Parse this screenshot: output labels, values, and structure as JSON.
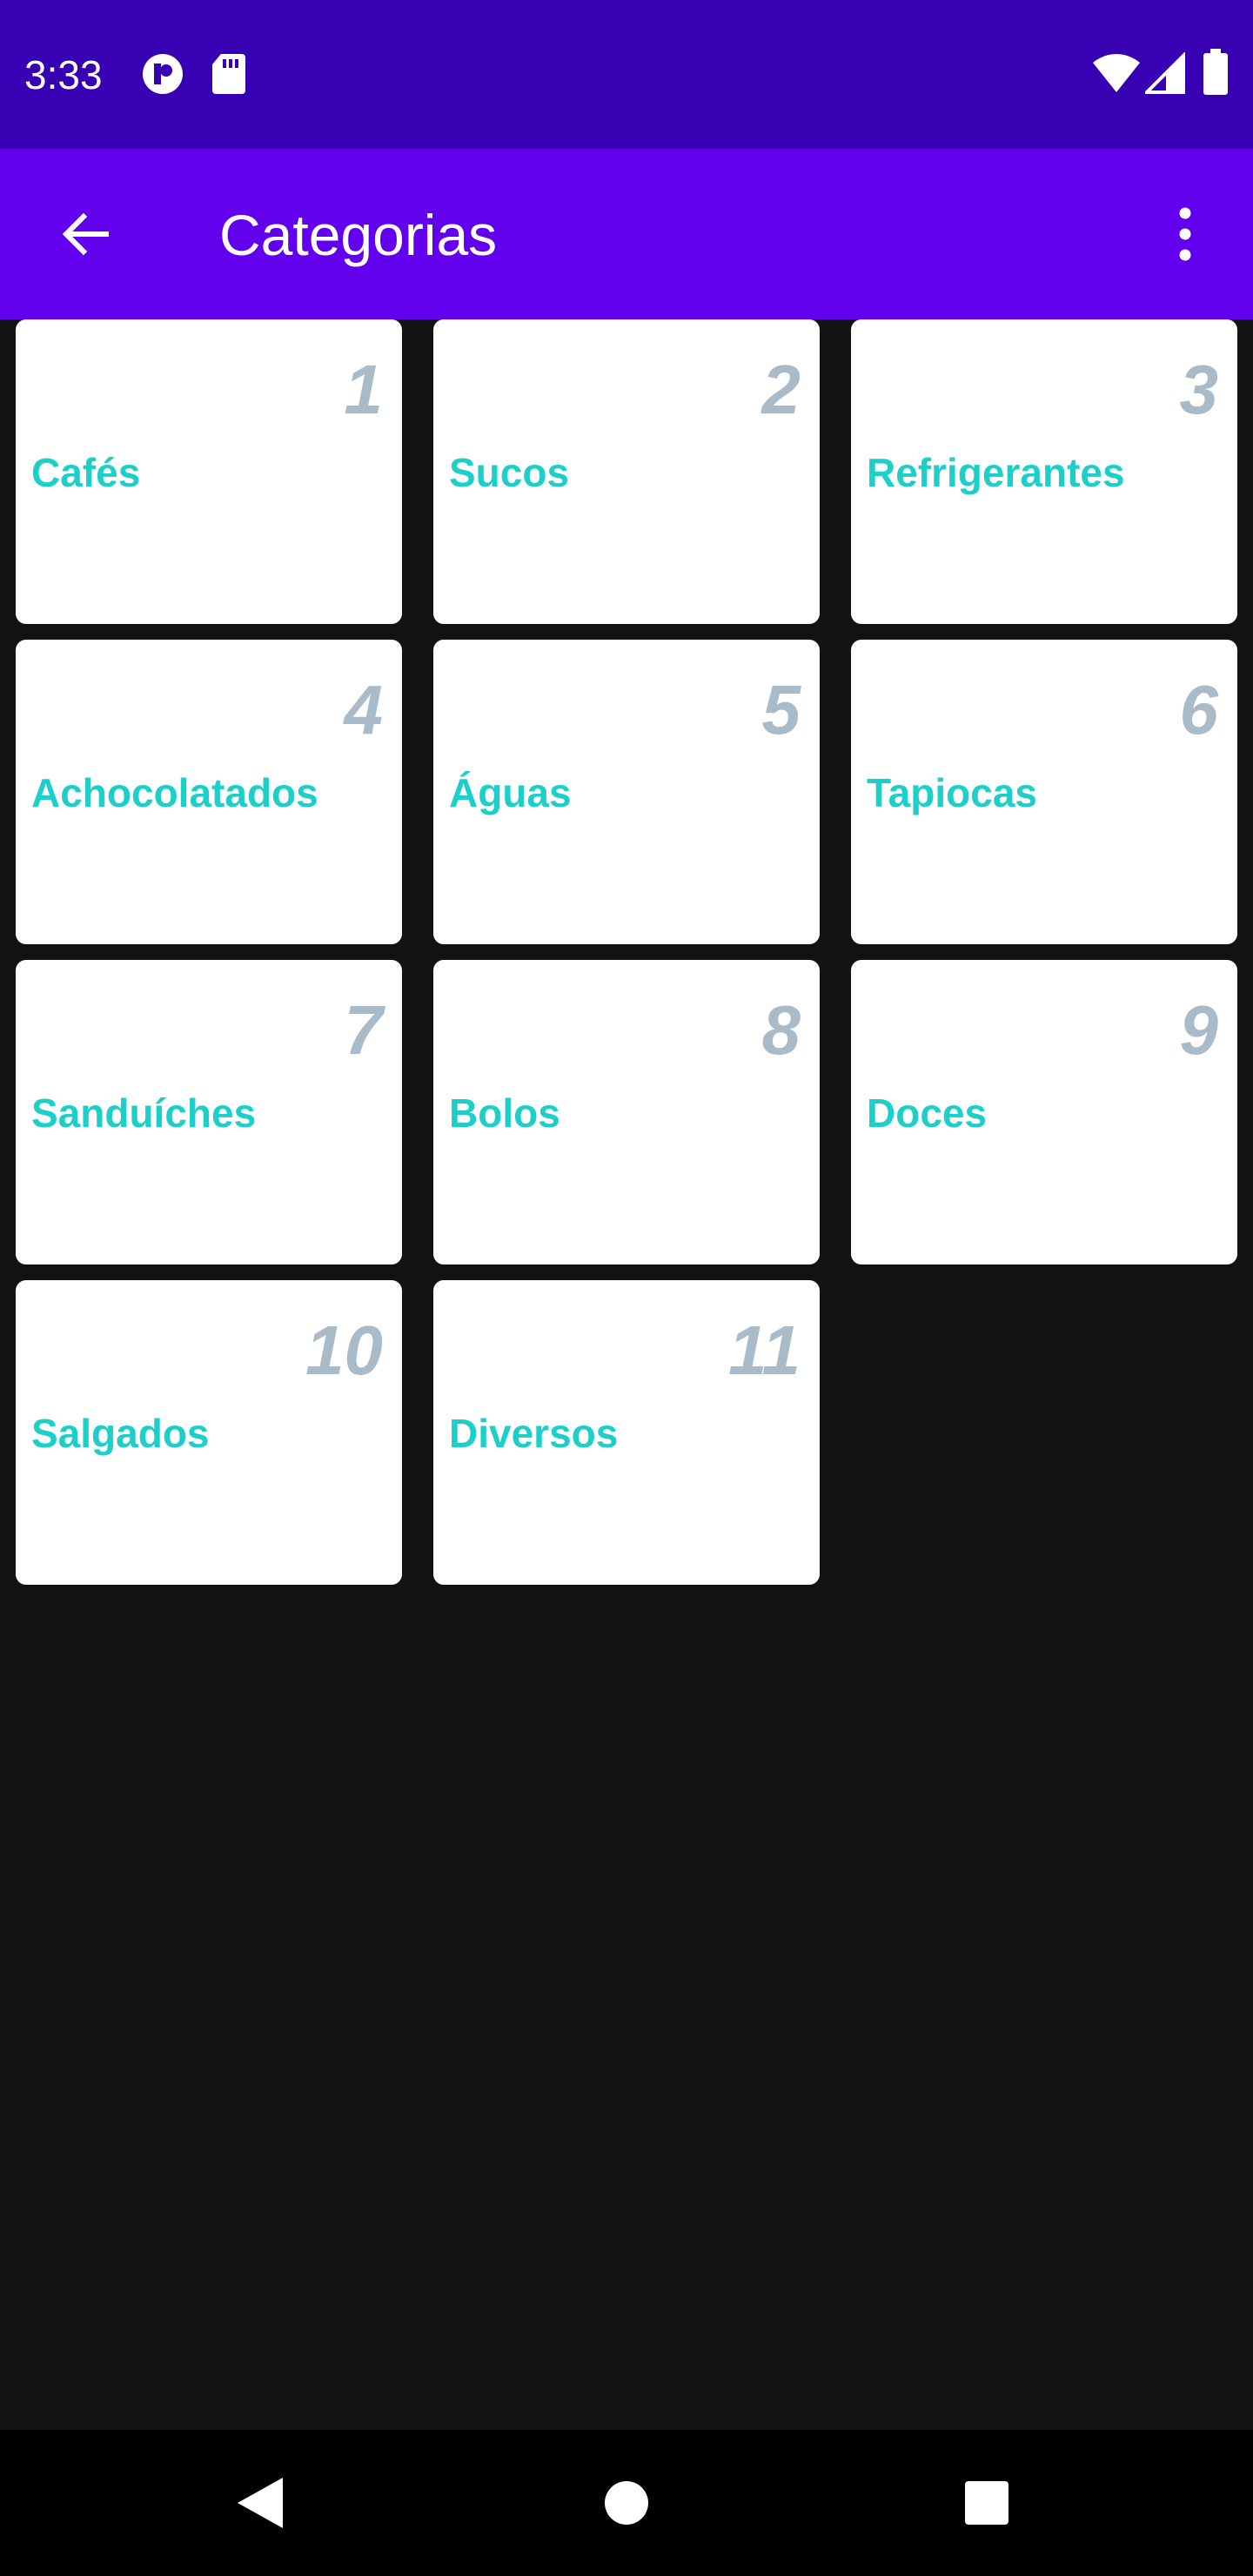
{
  "status_bar": {
    "time": "3:33",
    "icons": [
      "record-icon",
      "sd-card-icon",
      "wifi-icon",
      "signal-icon",
      "battery-icon"
    ]
  },
  "app_bar": {
    "title": "Categorias",
    "back_icon": "arrow-back-icon",
    "menu_icon": "more-vert-icon"
  },
  "categories": [
    {
      "number": "1",
      "name": "Cafés"
    },
    {
      "number": "2",
      "name": "Sucos"
    },
    {
      "number": "3",
      "name": "Refrigerantes"
    },
    {
      "number": "4",
      "name": "Achocolatados"
    },
    {
      "number": "5",
      "name": "Águas"
    },
    {
      "number": "6",
      "name": "Tapiocas"
    },
    {
      "number": "7",
      "name": "Sanduíches"
    },
    {
      "number": "8",
      "name": "Bolos"
    },
    {
      "number": "9",
      "name": "Doces"
    },
    {
      "number": "10",
      "name": "Salgados"
    },
    {
      "number": "11",
      "name": "Diversos"
    }
  ],
  "nav_bar": {
    "icons": [
      "nav-back-icon",
      "nav-home-icon",
      "nav-recents-icon"
    ]
  },
  "colors": {
    "status_bar": "#3700b3",
    "app_bar": "#6200ee",
    "background": "#121212",
    "card": "#ffffff",
    "category_name": "#1ccfc9",
    "category_number": "#a9bac8"
  }
}
